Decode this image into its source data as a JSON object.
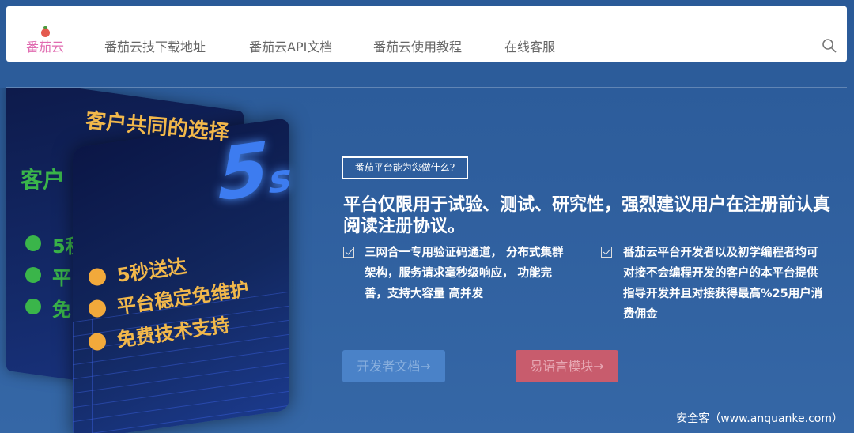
{
  "nav": {
    "brand": "番茄云",
    "items": [
      "番茄云技下载地址",
      "番茄云API文档",
      "番茄云使用教程",
      "在线客服"
    ]
  },
  "illustration": {
    "back_title": "客户",
    "back_items": [
      "5秒",
      "平",
      "免"
    ],
    "front_title": "客户共同的选择",
    "front_items": [
      "5秒送达",
      "平台稳定免维护",
      "免费技术支持"
    ],
    "big_number": "5",
    "big_unit": "s"
  },
  "hero": {
    "tag": "番茄平台能为您做什么?",
    "headline": "平台仅限用于试验、测试、研究性，强烈建议用户在注册前认真阅读注册协议。",
    "features": [
      {
        "line1": "三网合一专用验证码通道，  分布式集群",
        "line2": "架构，服务请求毫秒级响应，  功能完",
        "line3": "善，支持大容量 高并发",
        "line4": ""
      },
      {
        "line1": "番茄云平台开发者以及初学编程者均可",
        "line2": "对接不会编程开发的客户的本平台提供",
        "line3": "指导开发并且对接获得最高%25用户消",
        "line4": "费佣金"
      }
    ],
    "buttons": {
      "docs": "开发者文档→",
      "module": "易语言模块→"
    }
  },
  "watermark": "安全客（www.anquanke.com）",
  "colors": {
    "brand_pink": "#e06bb0",
    "btn_blue": "#4a82c8",
    "btn_red": "#c85c6d",
    "accent_green": "#3ab54a",
    "accent_orange": "#f2a93b"
  }
}
